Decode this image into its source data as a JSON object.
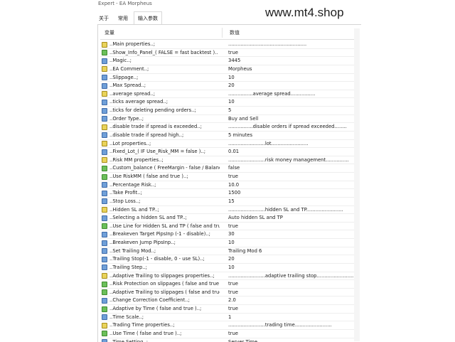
{
  "window": {
    "title": "Expert - EA Morpheus"
  },
  "watermark": "www.mt4.shop",
  "tabs": [
    {
      "label": "关于"
    },
    {
      "label": "常用"
    },
    {
      "label": "输入参数"
    }
  ],
  "table": {
    "headers": {
      "variable": "变量",
      "value": "数值"
    },
    "rows": [
      {
        "icon": "y",
        "name": "..Main properties..;",
        "value": "..................................................."
      },
      {
        "icon": "g",
        "name": "..Show_Info_Panel_( FALSE = fast backtest )..",
        "value": "true"
      },
      {
        "icon": "b",
        "name": "..Magic..;",
        "value": "3445"
      },
      {
        "icon": "y",
        "name": "..EA Comment..;",
        "value": "Morpheus"
      },
      {
        "icon": "b",
        "name": "..Slippage..;",
        "value": "10"
      },
      {
        "icon": "b",
        "name": "..Max Spread..;",
        "value": "20"
      },
      {
        "icon": "y",
        "name": "..average spread..;",
        "value": "................average spread................"
      },
      {
        "icon": "b",
        "name": "..ticks average spread..;",
        "value": "10"
      },
      {
        "icon": "b",
        "name": "..ticks for deleting pending orders..;",
        "value": "5"
      },
      {
        "icon": "b",
        "name": "..Order Type..;",
        "value": "Buy and Sell"
      },
      {
        "icon": "y",
        "name": "..disable trade if spread is exceeded..;",
        "value": "................disable orders if spread exceeded........"
      },
      {
        "icon": "b",
        "name": "..disable trade if spread high..;",
        "value": "5 minutes"
      },
      {
        "icon": "y",
        "name": "..Lot properties..;",
        "value": "........................lot........................"
      },
      {
        "icon": "b",
        "name": "..Fixed_Lot_( IF  Use_Risk_MM = false )..;",
        "value": "0.01"
      },
      {
        "icon": "y",
        "name": "..Risk MM properties..;",
        "value": "........................risk money management..............."
      },
      {
        "icon": "g",
        "name": "..Custom_balance ( FreeMargin - false / Balance ...",
        "value": "false"
      },
      {
        "icon": "g",
        "name": "..Use RiskMM ( false and true )..;",
        "value": "true"
      },
      {
        "icon": "b",
        "name": "..Percentage Risk..;",
        "value": "10.0"
      },
      {
        "icon": "b",
        "name": "..Take Profit..;",
        "value": "1500"
      },
      {
        "icon": "b",
        "name": "..Stop Loss..;",
        "value": "15"
      },
      {
        "icon": "y",
        "name": "..Hidden SL and TP..;",
        "value": "........................hidden SL and TP........................"
      },
      {
        "icon": "b",
        "name": "..Selecting a hidden SL and TP..;",
        "value": "Auto hidden SL and TP"
      },
      {
        "icon": "g",
        "name": "..Use Line for Hidden SL and TP ( false and true )..;",
        "value": "true"
      },
      {
        "icon": "b",
        "name": "..Breakeven Target PipsInp (-1 - disable)..;",
        "value": "30"
      },
      {
        "icon": "b",
        "name": "..Breakeven Jump PipsInp..;",
        "value": "10"
      },
      {
        "icon": "b",
        "name": "..Set Trailing Mod..;",
        "value": "Trailing Mod 6"
      },
      {
        "icon": "b",
        "name": "..Trailing Stop(-1 - disable, 0 - use SL)..;",
        "value": "20"
      },
      {
        "icon": "b",
        "name": "..Trailing Step..;",
        "value": "10"
      },
      {
        "icon": "y",
        "name": "..Adaptive Trailing to slippages properties..;",
        "value": "........................adaptive trailing stop........................"
      },
      {
        "icon": "g",
        "name": "..Risk Protection on slippages ( false and true )..;",
        "value": "true"
      },
      {
        "icon": "g",
        "name": "..Adaptive Trailing to slippages ( false and true )..;",
        "value": "true"
      },
      {
        "icon": "b",
        "name": "..Change Correction Coefficient..;",
        "value": "2.0"
      },
      {
        "icon": "g",
        "name": "..Adaptive by Time ( false and true )..;",
        "value": "true"
      },
      {
        "icon": "b",
        "name": "..Time Scale..;",
        "value": "1"
      },
      {
        "icon": "y",
        "name": "..Trading Time properties..;",
        "value": "........................trading time........................"
      },
      {
        "icon": "g",
        "name": "..Use Time ( false and true )..;",
        "value": "true"
      },
      {
        "icon": "b",
        "name": "..Time Setting..;",
        "value": "Server Time"
      }
    ]
  }
}
